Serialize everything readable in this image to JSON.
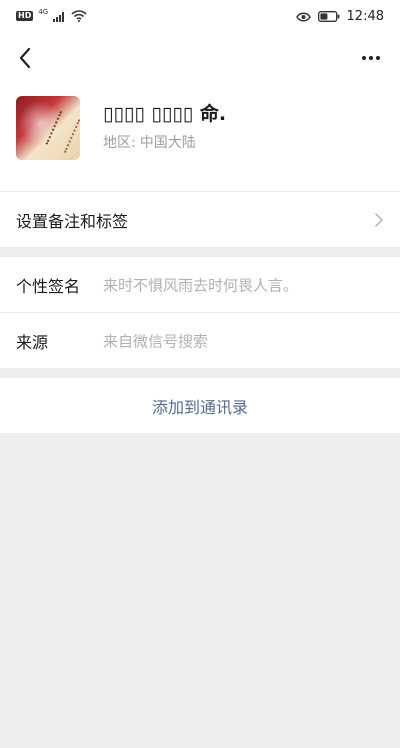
{
  "status_bar": {
    "hd_label": "HD",
    "network_label": "4G",
    "time": "12:48",
    "icons": [
      "signal-icon",
      "wifi-icon",
      "eye-comfort-icon",
      "battery-icon"
    ]
  },
  "profile": {
    "name": "▯▯▯▯ ▯▯▯▯ 命.",
    "region_label": "地区:",
    "region_value": "中国大陆"
  },
  "settings": {
    "remark_tags_label": "设置备注和标签"
  },
  "details": {
    "signature_label": "个性签名",
    "signature_value": "来时不惧风雨去时何畏人言。",
    "source_label": "来源",
    "source_value": "来自微信号搜索"
  },
  "actions": {
    "add_contact_label": "添加到通讯录"
  },
  "colors": {
    "background": "#ededed",
    "surface": "#ffffff",
    "link_blue": "#576b95",
    "secondary_text": "#9e9e9e",
    "value_text": "#b2b2b2"
  }
}
